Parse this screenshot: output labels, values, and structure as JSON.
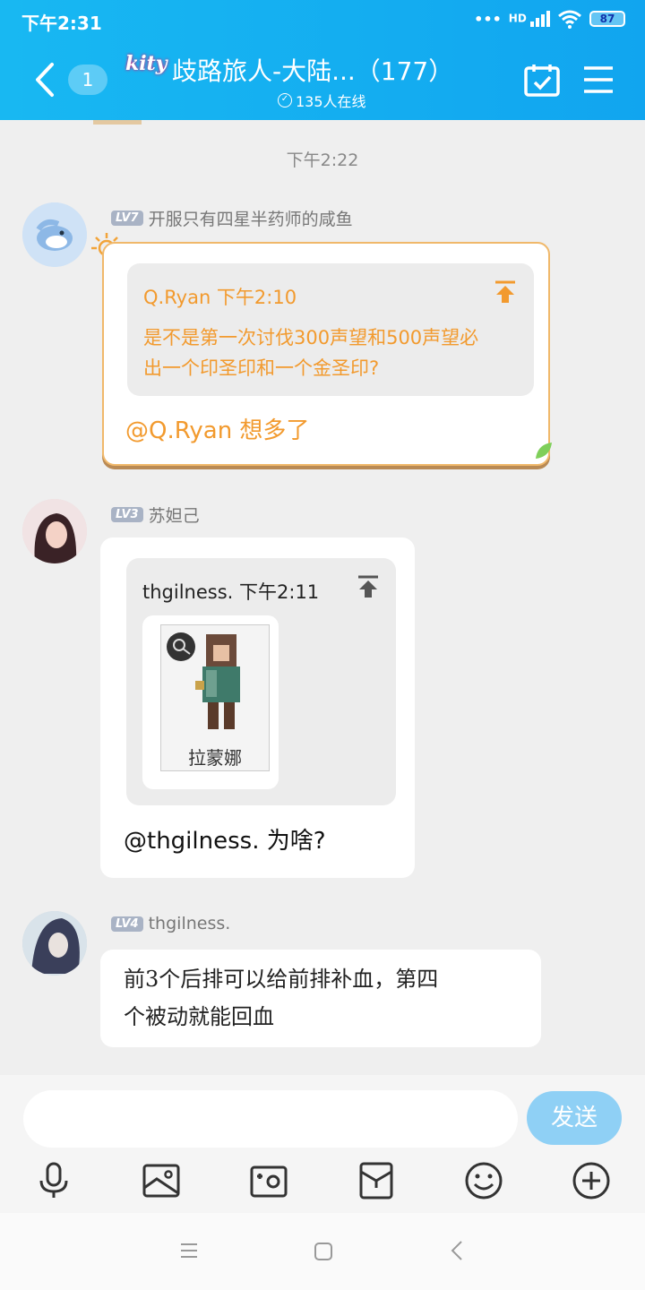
{
  "status_bar": {
    "time": "下午2:31",
    "signal_label": "HD",
    "battery": "87"
  },
  "header": {
    "unread_count": "1",
    "group_logo_text": "kity",
    "title": "歧路旅人-大陆...（177）",
    "online": "135人在线"
  },
  "chat": {
    "timestamp": "下午2:22",
    "messages": [
      {
        "level": "LV7",
        "sender": "开服只有四星半药师的咸鱼",
        "quote_author": "Q.Ryan 下午2:10",
        "quote_text_line1": "是不是第一次讨伐300声望和500声望必",
        "quote_text_line2": "出一个印圣印和一个金圣印?",
        "text": "@Q.Ryan 想多了"
      },
      {
        "level": "LV3",
        "sender": "苏妲己",
        "quote_author": "thgilness. 下午2:11",
        "quote_image_caption": "拉蒙娜",
        "text": "@thgilness. 为啥?"
      },
      {
        "level": "LV4",
        "sender": "thgilness.",
        "text_line1": "前3个后排可以给前排补血，第四",
        "text_line2": "个被动就能回血"
      }
    ]
  },
  "input": {
    "placeholder": "",
    "send_label": "发送"
  },
  "colors": {
    "header_blue": "#15b0f0",
    "quote_orange": "#f29a2e",
    "send_button": "#8fd0f5"
  }
}
